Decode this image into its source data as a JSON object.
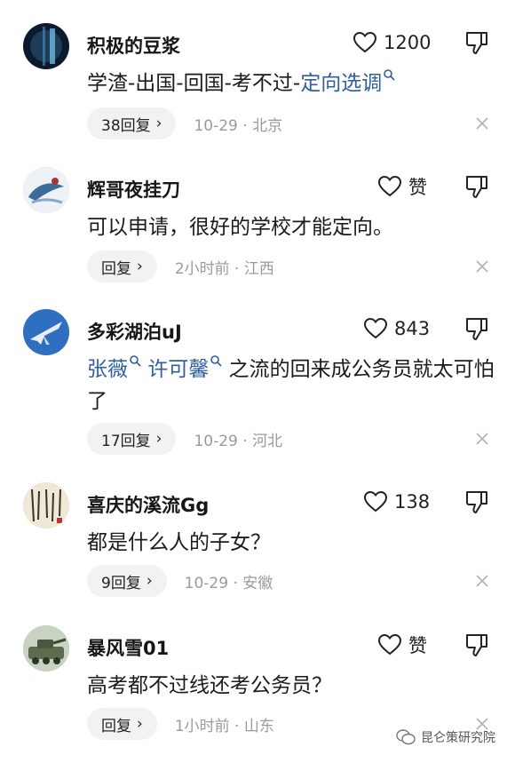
{
  "comments": [
    {
      "username": "积极的豆浆",
      "like_count": "1200",
      "content_pre": "学渣-出国-回国-考不过-",
      "link1": "定向选调",
      "link2": "",
      "content_post": "",
      "reply_label": "38回复",
      "date": "10-29",
      "location": "北京"
    },
    {
      "username": "辉哥夜挂刀",
      "like_count": "赞",
      "content_pre": "可以申请，很好的学校才能定向。",
      "link1": "",
      "link2": "",
      "content_post": "",
      "reply_label": "回复",
      "date": "2小时前",
      "location": "江西"
    },
    {
      "username": "多彩湖泊uJ",
      "like_count": "843",
      "content_pre": "",
      "link1": "张薇",
      "link2": "许可馨",
      "content_post": "之流的回来成公务员就太可怕了",
      "reply_label": "17回复",
      "date": "10-29",
      "location": "河北"
    },
    {
      "username": "喜庆的溪流Gg",
      "like_count": "138",
      "content_pre": "都是什么人的子女？",
      "link1": "",
      "link2": "",
      "content_post": "",
      "reply_label": "9回复",
      "date": "10-29",
      "location": "安徽"
    },
    {
      "username": "暴风雪01",
      "like_count": "赞",
      "content_pre": "高考都不过线还考公务员？",
      "link1": "",
      "link2": "",
      "content_post": "",
      "reply_label": "回复",
      "date": "1小时前",
      "location": "山东"
    }
  ],
  "meta_separator": "·",
  "reply_chevron": "›",
  "watermark": {
    "text": "昆仑策研究院"
  },
  "colors": {
    "link": "#2f5f9e",
    "meta": "#9a9a9a",
    "reply_bg": "#f2f2f2"
  }
}
